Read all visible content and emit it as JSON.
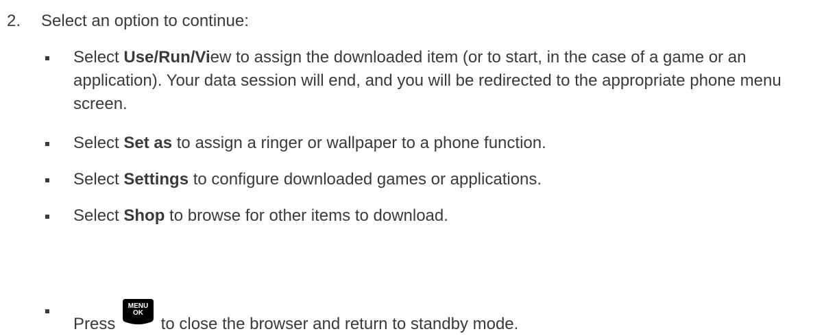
{
  "step": {
    "number": "2.",
    "text": "Select an option to continue:"
  },
  "bullets": [
    {
      "pre": "Select ",
      "bold": "Use/Run/Vi",
      "post": "ew to assign the downloaded item (or to start, in the case of a game or an application). Your data session will end, and you will be redirected to the appropriate phone menu screen."
    },
    {
      "pre": "Select ",
      "bold": "Set as",
      "post": " to assign a ringer or wallpaper to a phone function."
    },
    {
      "pre": "Select ",
      "bold": "Settings",
      "post": " to configure downloaded games or applications."
    },
    {
      "pre": "Select ",
      "bold": "Shop",
      "post": " to browse for other items to download."
    },
    {
      "pre": "Press ",
      "key_line1": "MENU",
      "key_line2": "OK",
      "post": " to close the browser and return to standby mode."
    }
  ],
  "icons": {
    "key": "menu-ok-key-icon",
    "bullet": "square-bullet-icon"
  },
  "colors": {
    "text": "#3a3a3a",
    "key_background": "#000000",
    "key_text": "#ffffff"
  }
}
